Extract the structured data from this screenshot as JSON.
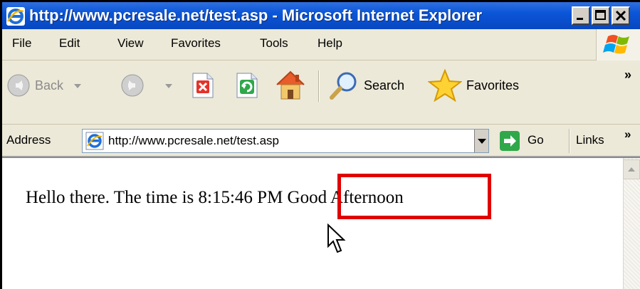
{
  "window": {
    "title": "http://www.pcresale.net/test.asp - Microsoft Internet Explorer"
  },
  "menu": {
    "items": [
      "File",
      "Edit",
      "View",
      "Favorites",
      "Tools",
      "Help"
    ]
  },
  "toolbar": {
    "back_label": "Back",
    "search_label": "Search",
    "favorites_label": "Favorites",
    "overflow": "»"
  },
  "address": {
    "label": "Address",
    "value": "http://www.pcresale.net/test.asp",
    "go_label": "Go",
    "links_label": "Links",
    "links_overflow": "»"
  },
  "page": {
    "text": "Hello there. The time is 8:15:46 PM Good Afternoon"
  },
  "colors": {
    "titlebar": "#0a56d8",
    "chrome": "#ece9d8",
    "highlight": "#e00000"
  }
}
